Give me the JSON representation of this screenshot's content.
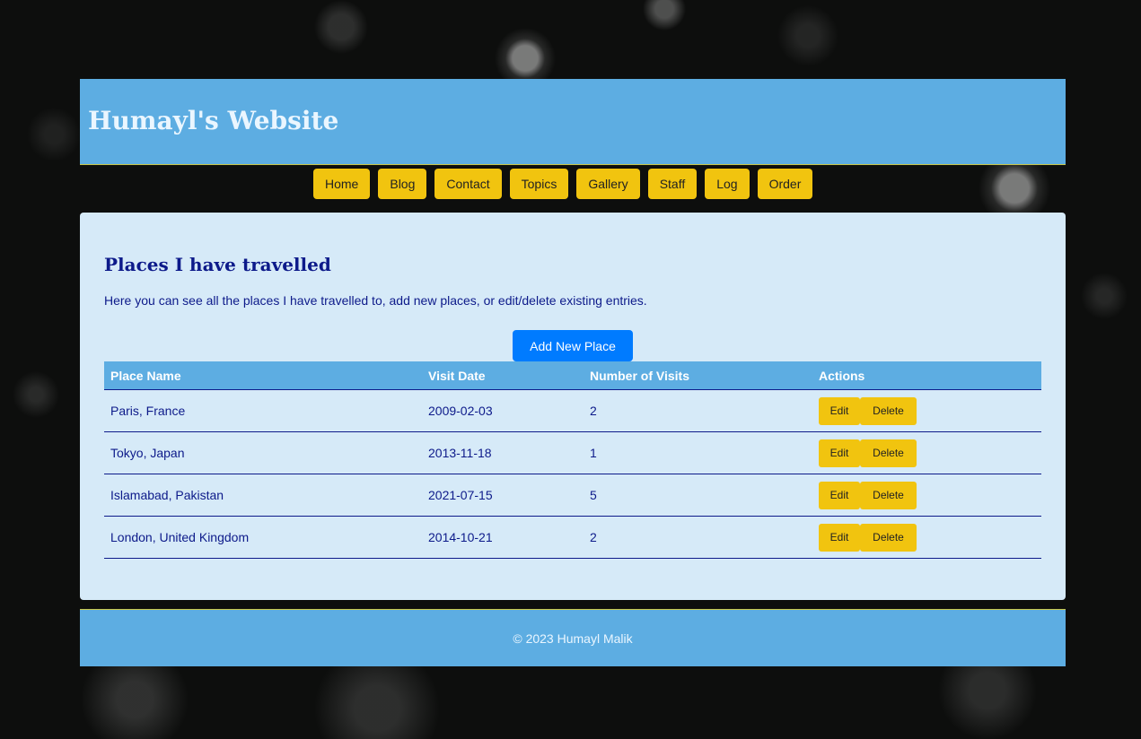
{
  "header": {
    "title": "Humayl's Website"
  },
  "nav": {
    "items": [
      {
        "label": "Home"
      },
      {
        "label": "Blog"
      },
      {
        "label": "Contact"
      },
      {
        "label": "Topics"
      },
      {
        "label": "Gallery"
      },
      {
        "label": "Staff"
      },
      {
        "label": "Log"
      },
      {
        "label": "Order"
      }
    ]
  },
  "main": {
    "heading": "Places I have travelled",
    "intro": "Here you can see all the places I have travelled to, add new places, or edit/delete existing entries.",
    "add_button": "Add New Place",
    "table": {
      "headers": [
        "Place Name",
        "Visit Date",
        "Number of Visits",
        "Actions"
      ],
      "rows": [
        {
          "place": "Paris, France",
          "date": "2009-02-03",
          "visits": "2",
          "edit": "Edit",
          "delete": "Delete"
        },
        {
          "place": "Tokyo, Japan",
          "date": "2013-11-18",
          "visits": "1",
          "edit": "Edit",
          "delete": "Delete"
        },
        {
          "place": "Islamabad, Pakistan",
          "date": "2021-07-15",
          "visits": "5",
          "edit": "Edit",
          "delete": "Delete"
        },
        {
          "place": "London, United Kingdom",
          "date": "2014-10-21",
          "visits": "2",
          "edit": "Edit",
          "delete": "Delete"
        }
      ]
    }
  },
  "footer": {
    "copyright": "© 2023 Humayl Malik"
  },
  "colors": {
    "header_bg": "#5dade2",
    "nav_button": "#f1c40f",
    "panel_bg": "#d6eaf8",
    "primary_button": "#007bff",
    "text_dark_blue": "#0d1a8a"
  }
}
